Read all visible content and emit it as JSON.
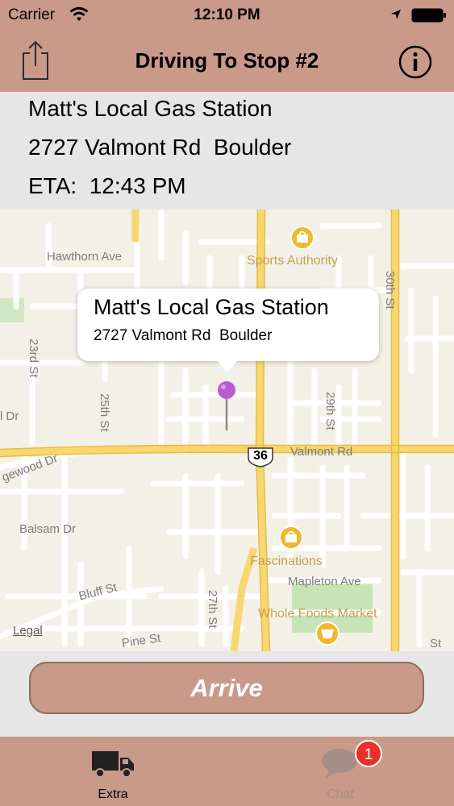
{
  "status_bar": {
    "carrier": "Carrier",
    "time": "12:10 PM",
    "icons": [
      "wifi-icon",
      "location-arrow-icon",
      "battery-icon"
    ]
  },
  "nav_bar": {
    "title": "Driving To Stop #2",
    "left_icon": "share-icon",
    "right_icon": "info-icon"
  },
  "stop_details": {
    "name": "Matt's Local Gas Station",
    "address": "2727 Valmont Rd  Boulder",
    "eta": "ETA:  12:43 PM"
  },
  "map": {
    "callout": {
      "title": "Matt's Local Gas Station",
      "subtitle": "2727 Valmont Rd  Boulder"
    },
    "pin_color": "#b95ad6",
    "street_labels": {
      "hawthorn": "Hawthorn Ave",
      "thirtieth": "30th St",
      "twentythird": "23rd St",
      "twentyfifth": "25th St",
      "twentyninth": "29th St",
      "valmont": "Valmont Rd",
      "edgewood": "gewood Dr",
      "dr": "l Dr",
      "balsam": "Balsam Dr",
      "bluff": "Bluff St",
      "mapleton": "Mapleton Ave",
      "twentyseventh": "27th St",
      "pine": "Pine St",
      "bottom_right": "St"
    },
    "highway_shield": "36",
    "poi": {
      "sports_authority": "Sports Authority",
      "fascinations": "Fascinations",
      "whole_foods": "Whole Foods Market"
    },
    "legal": "Legal"
  },
  "actions": {
    "arrive": "Arrive"
  },
  "tab_bar": {
    "tabs": [
      {
        "label": "Extra",
        "icon": "truck-icon",
        "selected": true
      },
      {
        "label": "Chat",
        "icon": "chat-bubble-icon",
        "badge": "1",
        "selected": false
      }
    ]
  },
  "colors": {
    "theme": "#c9998a",
    "panel": "#e6e6e6",
    "map_road_major": "#f7d76f",
    "badge": "#e9302a"
  }
}
